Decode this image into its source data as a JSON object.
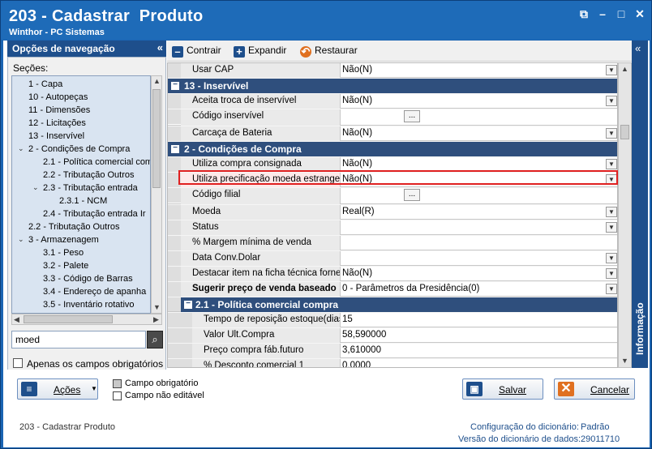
{
  "window": {
    "title": "203 - Cadastrar  Produto",
    "subtitle": "Winthor - PC Sistemas",
    "controls": [
      "restore-icon",
      "minimize-icon",
      "maximize-icon",
      "close-icon"
    ]
  },
  "nav": {
    "header": "Opções de navegação",
    "secoes_label": "Seções:",
    "tree": [
      {
        "label": "1 - Capa"
      },
      {
        "label": "10 - Autopeças"
      },
      {
        "label": "11 - Dimensões"
      },
      {
        "label": "12 - Licitações"
      },
      {
        "label": "13 - Inservível"
      },
      {
        "label": "2 - Condições de Compra"
      },
      {
        "label": "2.1 - Política comercial com"
      },
      {
        "label": "2.2 - Tributação Outros"
      },
      {
        "label": "2.3 - Tributação entrada"
      },
      {
        "label": "2.3.1 - NCM"
      },
      {
        "label": "2.4 - Tributação entrada Ir"
      },
      {
        "label": "2.2 - Tributação Outros"
      },
      {
        "label": "3 - Armazenagem"
      },
      {
        "label": "3.1 - Peso"
      },
      {
        "label": "3.2 - Palete"
      },
      {
        "label": "3.3 - Código de Barras"
      },
      {
        "label": "3.4 - Endereço de apanha"
      },
      {
        "label": "3.5 - Inventário rotativo"
      }
    ],
    "search_value": "moed",
    "only_required_label": "Apenas os campos obrigatórios"
  },
  "toolbar": {
    "contrair": "Contrair",
    "expandir": "Expandir",
    "restaurar": "Restaurar"
  },
  "grid": {
    "row_usar_cap": {
      "label": "Usar CAP",
      "value": "Não(N)"
    },
    "cat13": "13 - Inservível",
    "aceita_troca": {
      "label": "Aceita troca de inservível",
      "value": "Não(N)"
    },
    "codigo_inservivel": {
      "label": "Código inservível",
      "value": ""
    },
    "carcaca": {
      "label": "Carcaça de Bateria",
      "value": "Não(N)"
    },
    "cat2": "2 - Condições de Compra",
    "compra_consignada": {
      "label": "Utiliza compra consignada",
      "value": "Não(N)"
    },
    "precificacao_moeda": {
      "label": "Utiliza precificação moeda estrangeira",
      "value": "Não(N)"
    },
    "codigo_filial": {
      "label": "Código filial",
      "value": ""
    },
    "moeda": {
      "label": "Moeda",
      "value": "Real(R)"
    },
    "status": {
      "label": "Status",
      "value": ""
    },
    "margem": {
      "label": "% Margem mínima de venda",
      "value": ""
    },
    "data_conv": {
      "label": "Data Conv.Dolar",
      "value": ""
    },
    "destacar": {
      "label": "Destacar item na ficha técnica fornec",
      "value": "Não(N)"
    },
    "sugerir": {
      "label": "Sugerir preço de venda baseado",
      "value": "0 - Parâmetros da Presidência(0)"
    },
    "cat21": "2.1 - Política comercial compra",
    "tempo_reposicao": {
      "label": "Tempo de reposição estoque(dias)",
      "value": "15"
    },
    "valor_ult": {
      "label": "Valor Ult.Compra",
      "value": "58,590000"
    },
    "preco_compra": {
      "label": "Preço compra fáb.futuro",
      "value": "3,610000"
    },
    "desconto": {
      "label": "% Desconto comercial 1",
      "value": "0,0000"
    }
  },
  "info_tab": "Informação",
  "footer": {
    "acoes": "Ações",
    "legend_required": "Campo obrigatório",
    "legend_not_editable": "Campo não editável",
    "salvar": "Salvar",
    "cancelar": "Cancelar",
    "status_left": "203 - Cadastrar  Produto",
    "dict_config_label": "Configuração do dicionário:",
    "dict_config_value": "Padrão",
    "dict_version_label": "Versão do dicionário de dados:",
    "dict_version_value": "29011710"
  }
}
